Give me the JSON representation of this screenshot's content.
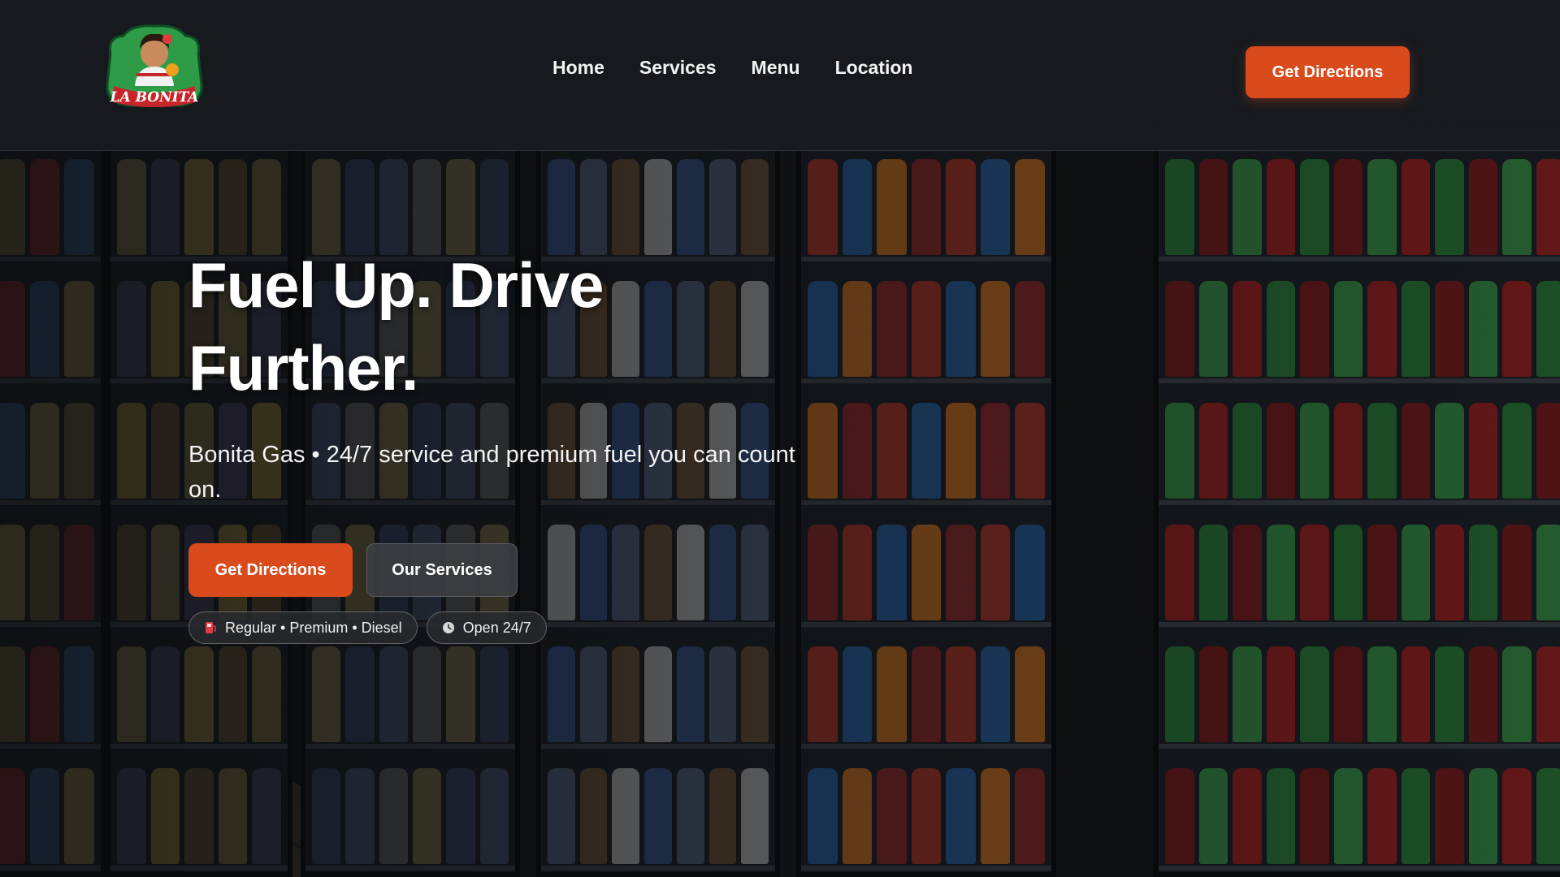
{
  "brand": {
    "logo_text": "LA BONITA",
    "colors": {
      "accent": "#d94a1d",
      "logo_green": "#2e9b47",
      "logo_red": "#c8252a"
    }
  },
  "nav": {
    "items": [
      {
        "label": "Home"
      },
      {
        "label": "Services"
      },
      {
        "label": "Menu"
      },
      {
        "label": "Location"
      }
    ],
    "cta_label": "Get Directions"
  },
  "hero": {
    "title_line1": "Fuel Up. Drive",
    "title_line2": "Further.",
    "subtitle": "Bonita Gas • 24/7 service and premium fuel you can count on.",
    "primary_button": "Get Directions",
    "secondary_button": "Our Services",
    "badges": [
      {
        "icon": "fuel-pump-icon",
        "label": "Regular • Premium • Diesel"
      },
      {
        "icon": "clock-icon",
        "label": "Open 24/7"
      }
    ]
  }
}
